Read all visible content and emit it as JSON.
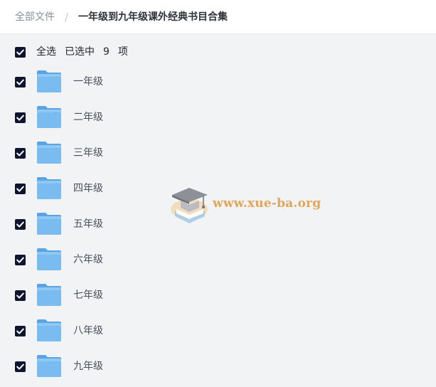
{
  "breadcrumb": {
    "root": "全部文件",
    "separator": "/",
    "current": "一年级到九年级课外经典书目合集"
  },
  "selection": {
    "select_all_label": "全选",
    "selected_prefix": "已选中",
    "selected_count": "9",
    "selected_suffix": "项",
    "all_checked": true
  },
  "folders": [
    {
      "name": "一年级",
      "checked": true
    },
    {
      "name": "二年级",
      "checked": true
    },
    {
      "name": "三年级",
      "checked": true
    },
    {
      "name": "四年级",
      "checked": true
    },
    {
      "name": "五年级",
      "checked": true
    },
    {
      "name": "六年级",
      "checked": true
    },
    {
      "name": "七年级",
      "checked": true
    },
    {
      "name": "八年级",
      "checked": true
    },
    {
      "name": "九年级",
      "checked": true
    }
  ],
  "watermark": {
    "text": "www.xue-ba.org"
  },
  "colors": {
    "checkbox": "#0f1430",
    "folder": "#6aaee8",
    "watermark": "#e0a65a",
    "background": "#f2f3f5"
  },
  "icons": {
    "folder": "folder-icon",
    "checkbox": "checkbox-checked-icon",
    "watermark_logo": "graduation-cap-logo"
  }
}
